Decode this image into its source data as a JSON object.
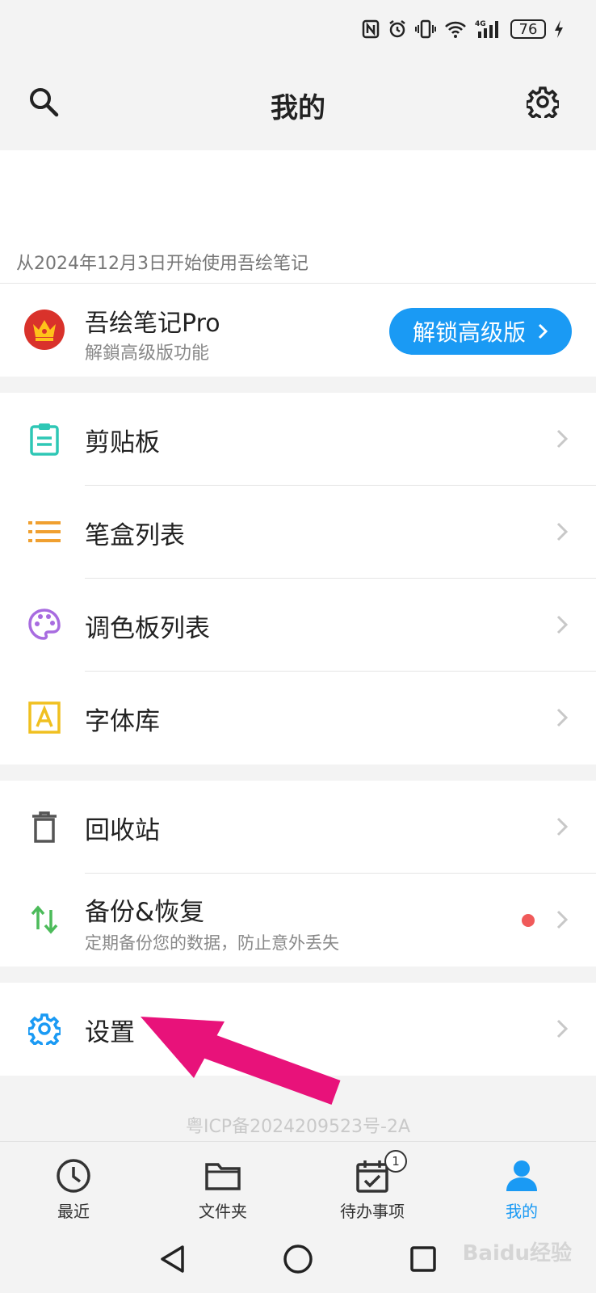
{
  "status": {
    "battery": "76",
    "network": "4G"
  },
  "header": {
    "title": "我的",
    "search_icon": "search-icon",
    "settings_icon": "gear-icon"
  },
  "since_text": "从2024年12月3日开始使用吾绘笔记",
  "pro": {
    "name": "吾绘笔记Pro",
    "sub": "解鎖高级版功能",
    "unlock_label": "解锁高级版",
    "accent": "#1a9af4"
  },
  "menu1": [
    {
      "label": "剪贴板",
      "icon": "clipboard-icon",
      "color": "#2ec7b5"
    },
    {
      "label": "笔盒列表",
      "icon": "list-icon",
      "color": "#f0a030"
    },
    {
      "label": "调色板列表",
      "icon": "palette-icon",
      "color": "#a86ce0"
    },
    {
      "label": "字体库",
      "icon": "font-icon",
      "color": "#f0c020"
    }
  ],
  "menu2": [
    {
      "label": "回收站",
      "icon": "trash-icon",
      "color": "#555555"
    },
    {
      "label": "备份&恢复",
      "sub": "定期备份您的数据，防止意外丢失",
      "icon": "sync-arrows-icon",
      "color": "#4cbb5a"
    }
  ],
  "menu3": [
    {
      "label": "设置",
      "icon": "gear-icon",
      "color": "#1a9af4"
    }
  ],
  "icp": "粤ICP备2024209523号-2A",
  "tabs": [
    {
      "label": "最近",
      "icon": "clock-icon"
    },
    {
      "label": "文件夹",
      "icon": "folder-icon"
    },
    {
      "label": "待办事项",
      "icon": "calendar-check-icon",
      "badge": "1"
    },
    {
      "label": "我的",
      "icon": "person-icon",
      "active": true
    }
  ],
  "watermark": "Baidu经验"
}
